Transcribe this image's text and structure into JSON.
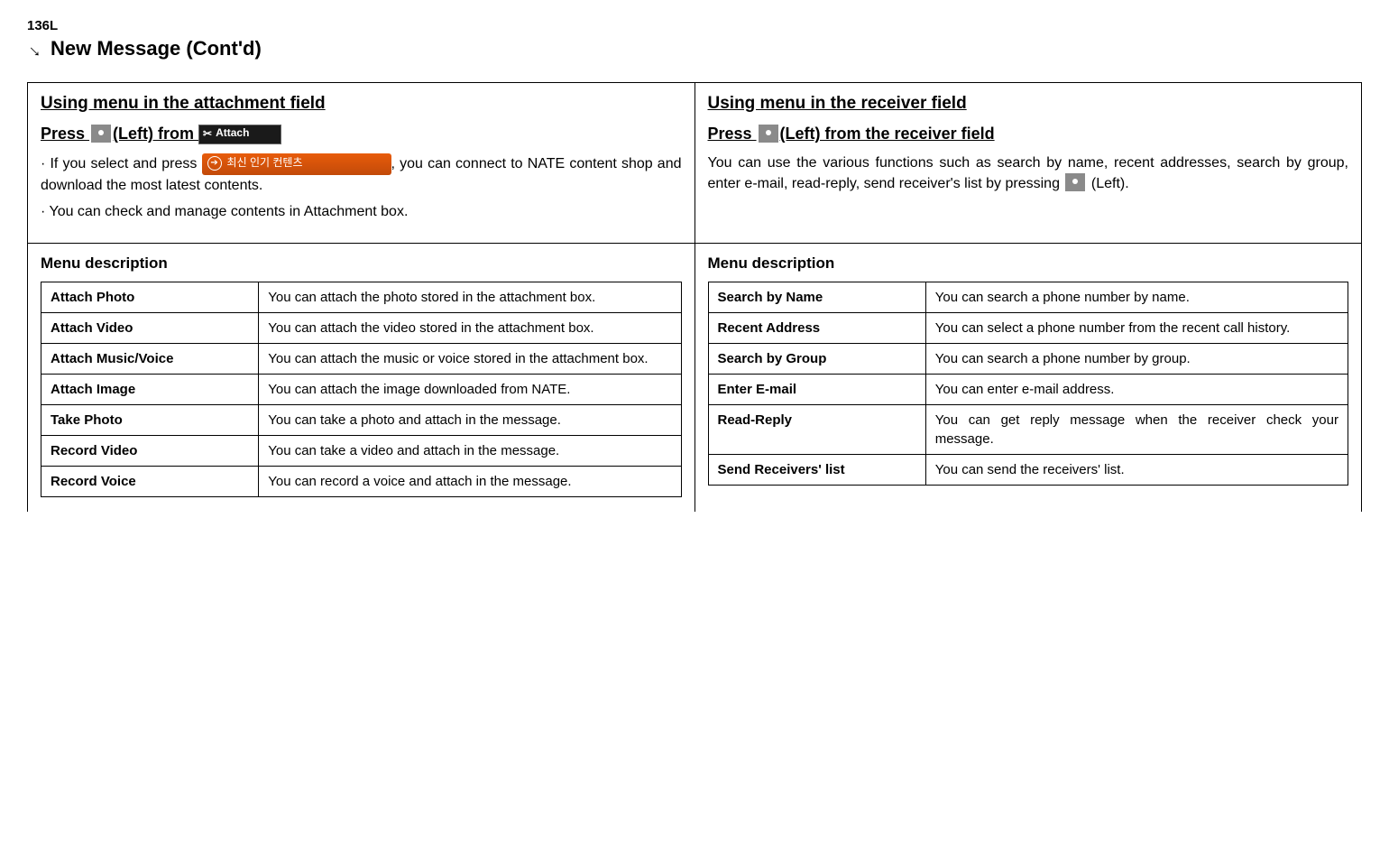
{
  "header": {
    "page_number": "136L",
    "title": "New Message (Cont'd)"
  },
  "left": {
    "section_heading": "Using menu in the attachment field",
    "press_prefix": "Press ",
    "press_mid": "(Left) from ",
    "attach_badge": "Attach",
    "body1_a": "· If you select and press ",
    "nate_label": "최신 인기 컨텐츠",
    "body1_b": ", you can connect to NATE content shop and download the most latest contents.",
    "body2": "· You can check and manage contents in Attachment box.",
    "menu_title": "Menu description",
    "rows": [
      {
        "label": "Attach Photo",
        "desc": "You can attach the photo stored in the attachment box."
      },
      {
        "label": "Attach Video",
        "desc": "You can attach the video stored in the attachment box."
      },
      {
        "label": "Attach Music/Voice",
        "desc": "You can attach the music or voice stored in the attachment box."
      },
      {
        "label": "Attach Image",
        "desc": "You can attach the image downloaded from NATE."
      },
      {
        "label": "Take Photo",
        "desc": "You can take a photo and attach in the message."
      },
      {
        "label": "Record Video",
        "desc": "You can take a video and attach in the message."
      },
      {
        "label": "Record Voice",
        "desc": "You can record a voice and attach in the message."
      }
    ]
  },
  "right": {
    "section_heading": "Using menu in the receiver field",
    "press_prefix": "Press ",
    "press_suffix": "(Left) from the receiver field",
    "body1_a": "You can use the various functions such as search by name, recent addresses, search by group, enter e-mail, read-reply, send receiver's list by pressing ",
    "body1_b": " (Left).",
    "menu_title": "Menu description",
    "rows": [
      {
        "label": "Search by Name",
        "desc": "You can search a phone number by name."
      },
      {
        "label": "Recent Address",
        "desc": "You can select a phone number from the recent call history."
      },
      {
        "label": "Search by Group",
        "desc": "You can search a phone number by group."
      },
      {
        "label": "Enter E-mail",
        "desc": "You can enter e-mail address."
      },
      {
        "label": "Read-Reply",
        "desc": "You can get reply message when the receiver check your message."
      },
      {
        "label": "Send Receivers' list",
        "desc": "You can send the receivers' list."
      }
    ]
  }
}
